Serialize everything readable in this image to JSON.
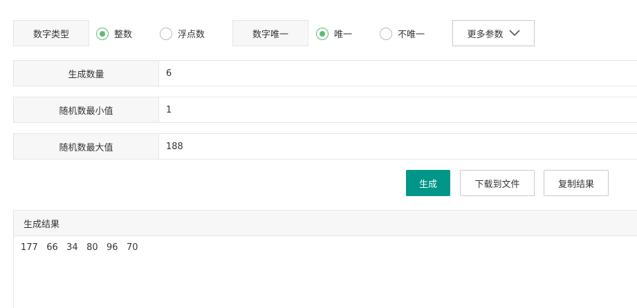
{
  "options": {
    "number_type": {
      "label": "数字类型",
      "choices": [
        {
          "label": "整数",
          "checked": true
        },
        {
          "label": "浮点数",
          "checked": false
        }
      ]
    },
    "unique": {
      "label": "数字唯一",
      "choices": [
        {
          "label": "唯一",
          "checked": true
        },
        {
          "label": "不唯一",
          "checked": false
        }
      ]
    },
    "more_params_label": "更多参数"
  },
  "fields": [
    {
      "label": "生成数量",
      "value": "6"
    },
    {
      "label": "随机数最小值",
      "value": "1"
    },
    {
      "label": "随机数最大值",
      "value": "188"
    }
  ],
  "actions": {
    "generate": "生成",
    "download": "下载到文件",
    "copy": "复制结果"
  },
  "result": {
    "title": "生成结果",
    "content": "177   66   34   80   96   70"
  },
  "colors": {
    "primary": "#009688",
    "radio_checked": "#5fb878"
  }
}
